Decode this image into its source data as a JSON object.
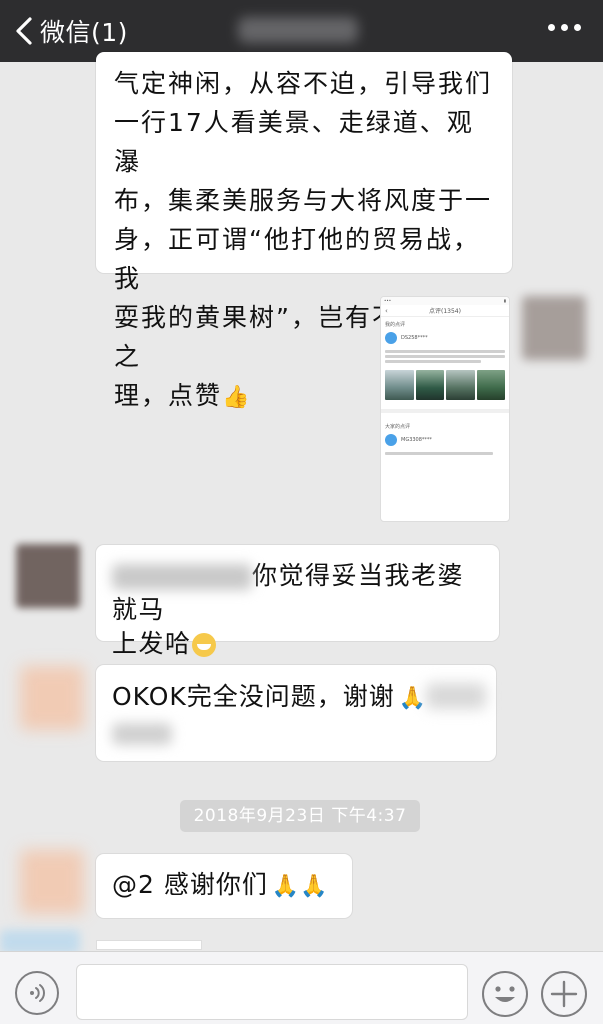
{
  "header": {
    "back_label": "微信(1)",
    "back_icon": "chevron-left-icon",
    "more_icon": "more-dots-icon",
    "background": "#2d2d2f"
  },
  "messages": [
    {
      "id": "m1",
      "lines": [
        "气定神闲，从容不迫，引导我们",
        "一行17人看美景、走绿道、观瀑",
        "布，集柔美服务与大将风度于一",
        "身，正可谓“他打他的贸易战，我",
        "耍我的黄果树”，岂有不评五星之",
        "理，点赞"
      ],
      "emoji": "👍"
    },
    {
      "id": "m2",
      "image": {
        "nav_title": "点评(1354)",
        "section1": "我的点评",
        "user1": "DS258****",
        "section2": "大家的点评",
        "user2": "MG3308****"
      }
    },
    {
      "id": "m3",
      "lines": [
        "你觉得妥当我老婆就马",
        "上发哈"
      ],
      "emoji": "😁"
    },
    {
      "id": "m4",
      "text": "OKOK完全没问题，谢谢",
      "emoji": "🙏"
    },
    {
      "id": "m5",
      "text": "@2 感谢你们",
      "emoji": "🙏🙏"
    }
  ],
  "timestamp": "2018年9月23日 下午4:37",
  "input_bar": {
    "voice_icon": "voice-icon",
    "emoji_icon": "emoji-icon",
    "plus_icon": "plus-icon",
    "value": ""
  }
}
